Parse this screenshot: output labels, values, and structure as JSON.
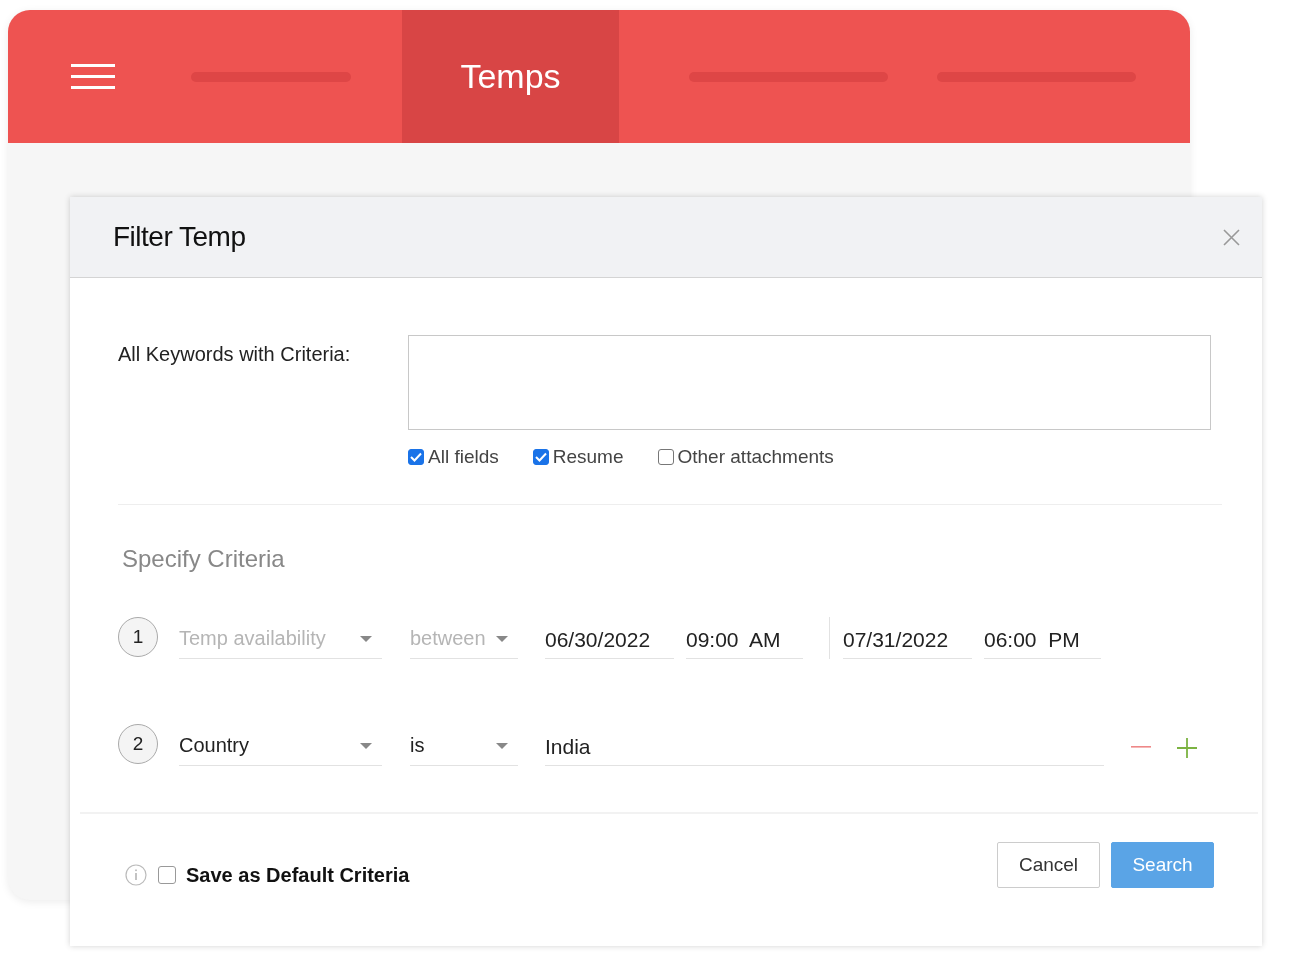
{
  "nav": {
    "tabs": [
      {
        "kind": "placeholder",
        "selected": false
      },
      {
        "kind": "label",
        "label": "Temps",
        "selected": true
      },
      {
        "kind": "placeholder",
        "selected": false
      },
      {
        "kind": "placeholder",
        "selected": false
      }
    ]
  },
  "dialog": {
    "title": "Filter Temp",
    "keywords": {
      "label": "All Keywords with Criteria:",
      "options": [
        {
          "label": "All fields",
          "checked": true
        },
        {
          "label": "Resume",
          "checked": true
        },
        {
          "label": "Other attachments",
          "checked": false
        }
      ]
    },
    "criteria_heading": "Specify Criteria",
    "criteria": [
      {
        "kind": "range",
        "number": "1",
        "field": "Temp availability",
        "field_disabled": true,
        "operator": "between",
        "operator_disabled": true,
        "from_date": "06/30/2022",
        "from_time": "09:00",
        "from_period": "AM",
        "to_date": "07/31/2022",
        "to_time": "06:00",
        "to_period": "PM"
      },
      {
        "kind": "single",
        "number": "2",
        "field": "Country",
        "field_disabled": false,
        "operator": "is",
        "operator_disabled": false,
        "value": "India"
      }
    ],
    "save_default": {
      "label": "Save as Default Criteria",
      "checked": false
    },
    "buttons": [
      {
        "kind": "secondary",
        "label": "Cancel"
      },
      {
        "kind": "primary",
        "label": "Search"
      }
    ]
  }
}
